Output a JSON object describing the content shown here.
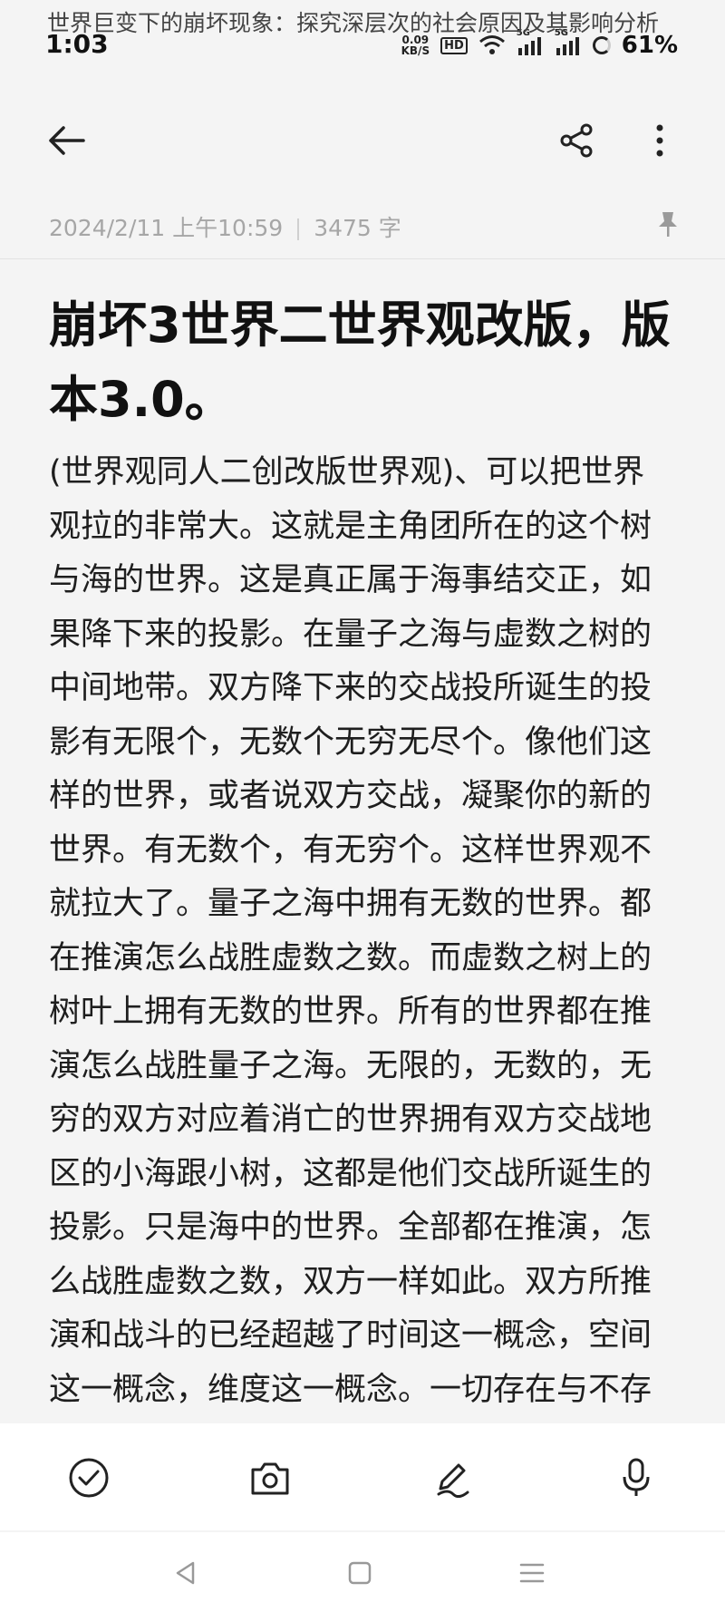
{
  "overlay_caption": "世界巨变下的崩坏现象：探究深层次的社会原因及其影响分析",
  "status_bar": {
    "time": "1:03",
    "net_speed_value": "0.09",
    "net_speed_unit": "KB/S",
    "hd_badge": "HD",
    "signal_1_label": "5G",
    "signal_2_label": "5G",
    "battery": "61%"
  },
  "toolbar": {
    "back_icon": "arrow-left",
    "share_icon": "share",
    "more_icon": "more-vertical"
  },
  "note": {
    "date": "2024/2/11 上午10:59",
    "word_count": "3475 字",
    "pin_icon": "pin",
    "title": "崩坏3世界二世界观改版，版本3.0。",
    "body": "(世界观同人二创改版世界观)、可以把世界观拉的非常大。这就是主角团所在的这个树与海的世界。这是真正属于海事结交正，如果降下来的投影。在量子之海与虚数之树的中间地带。双方降下来的交战投所诞生的投影有无限个，无数个无穷无尽个。像他们这样的世界，或者说双方交战，凝聚你的新的世界。有无数个，有无穷个。这样世界观不就拉大了。量子之海中拥有无数的世界。都在推演怎么战胜虚数之数。而虚数之树上的树叶上拥有无数的世界。所有的世界都在推演怎么战胜量子之海。无限的，无数的，无穷的双方对应着消亡的世界拥有双方交战地区的小海跟小树，这都是他们交战所诞生的投影。只是海中的世界。全部都在推演，怎么战胜虚数之数，双方一样如此。双方所推演和战斗的已经超越了时间这一概念，空间这一概念，维度这一概念。一切存在与不存"
  },
  "bottom_actions": {
    "checklist_icon": "check-circle",
    "camera_icon": "camera",
    "pen_icon": "pen",
    "mic_icon": "microphone"
  },
  "nav": {
    "back_icon": "triangle-back",
    "home_icon": "square-home",
    "recents_icon": "menu-lines"
  },
  "colors": {
    "background": "#f4f4f4",
    "meta_text": "#a6a6a6",
    "primary_text": "#111111"
  }
}
